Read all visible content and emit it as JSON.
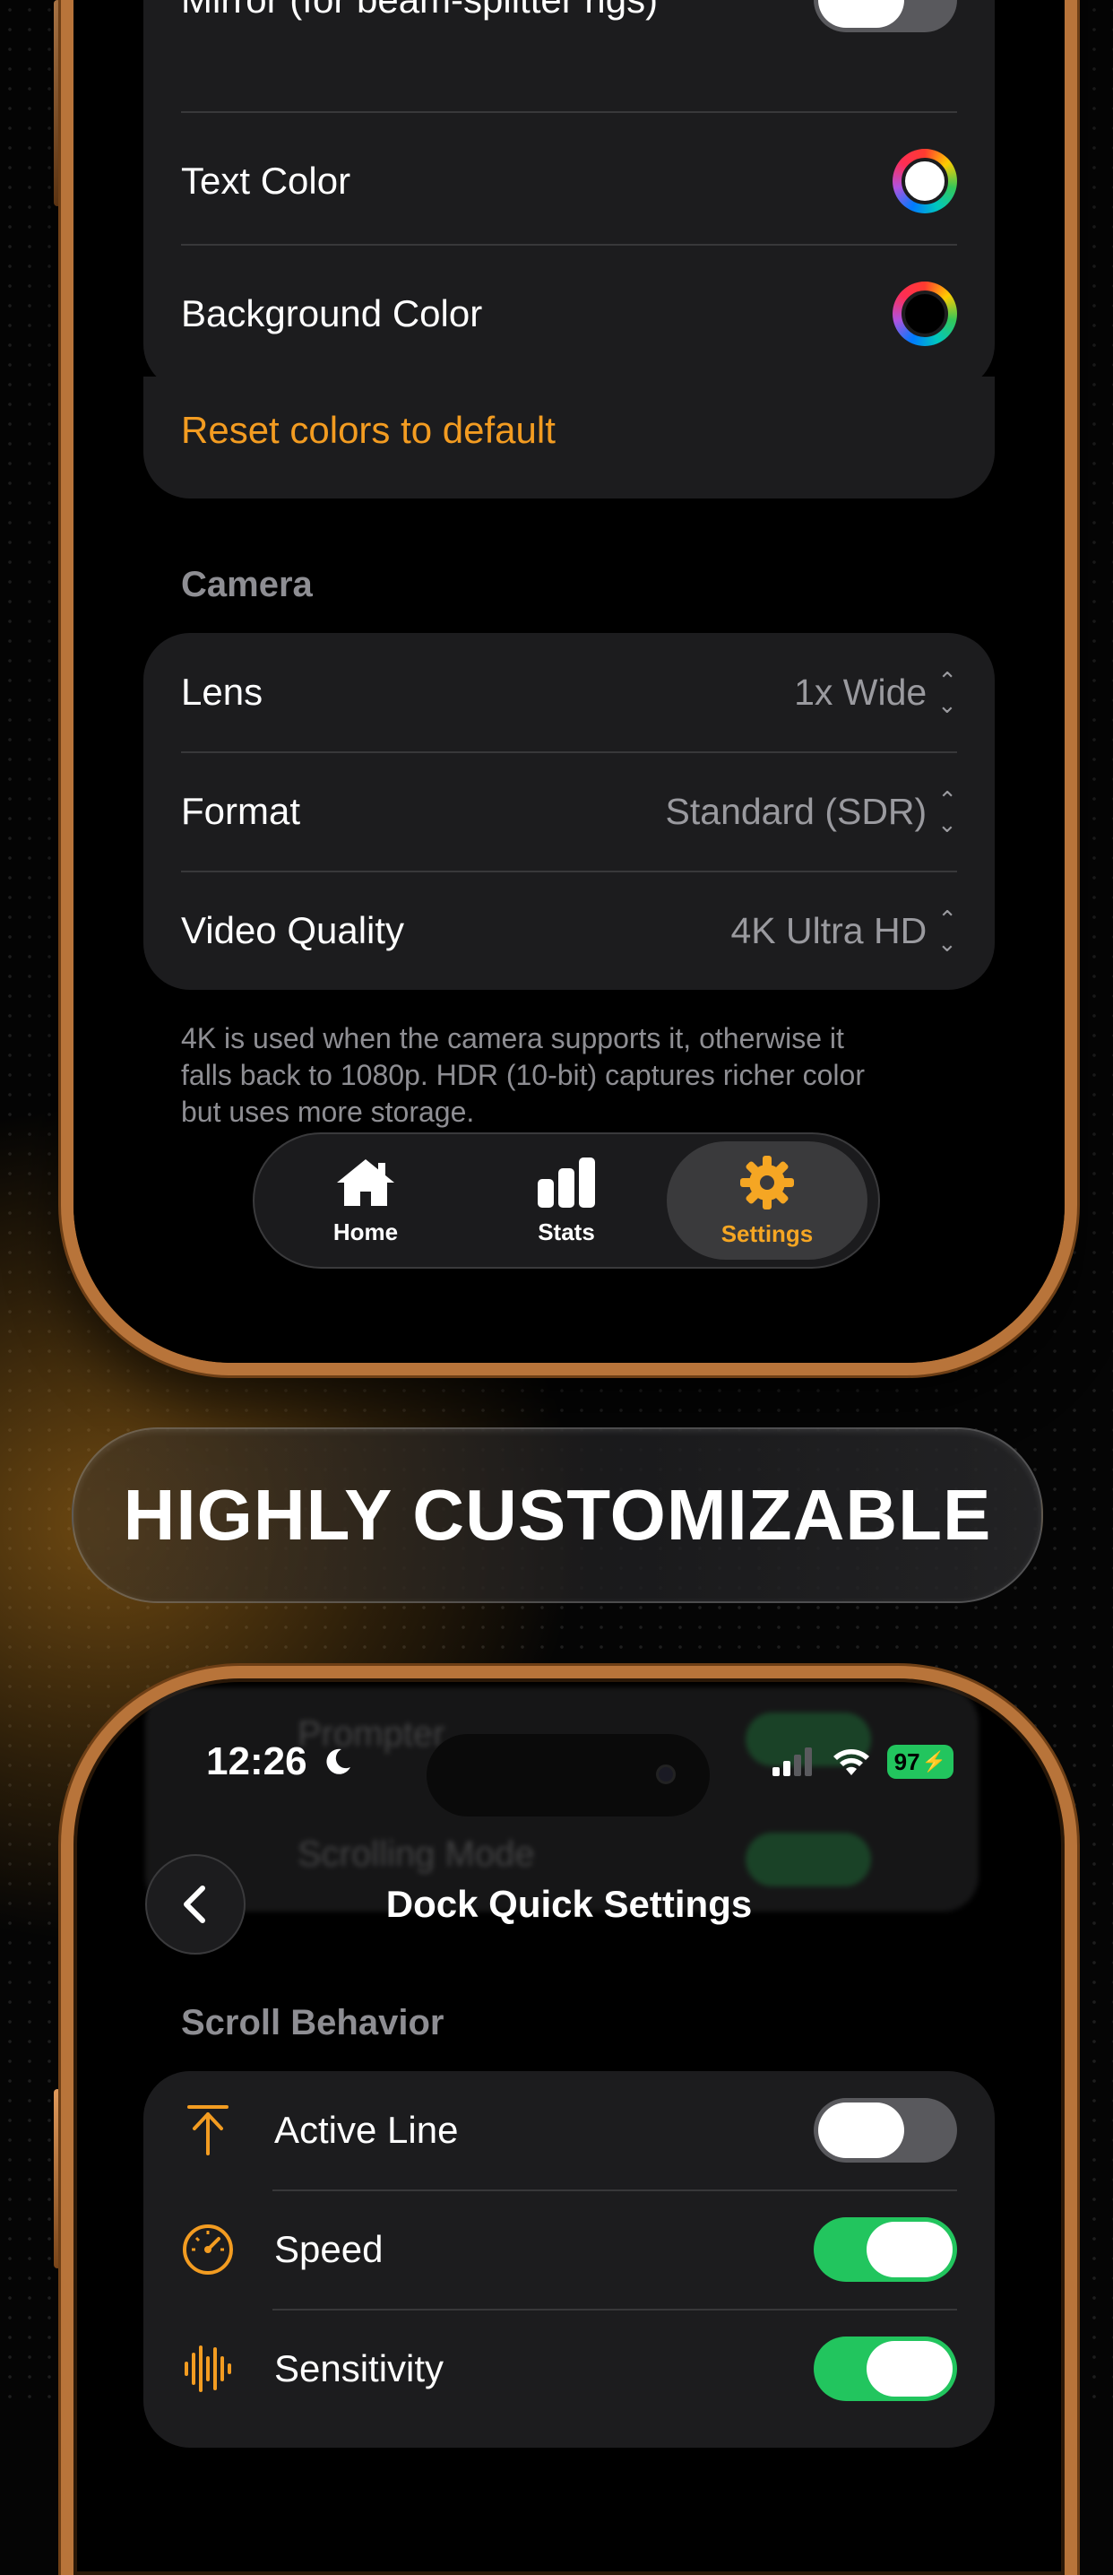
{
  "phone_top": {
    "display_card": {
      "rows": [
        {
          "label": "Mirror (for beam-splitter rigs)",
          "control": "toggle",
          "state": "off"
        },
        {
          "label": "Text Color",
          "control": "color-well",
          "color": "#ffffff"
        },
        {
          "label": "Background Color",
          "control": "color-well",
          "color": "#000000"
        }
      ],
      "reset_label": "Reset colors to default"
    },
    "camera": {
      "section_title": "Camera",
      "rows": [
        {
          "label": "Lens",
          "value": "1x Wide"
        },
        {
          "label": "Format",
          "value": "Standard (SDR)"
        },
        {
          "label": "Video Quality",
          "value": "4K Ultra HD"
        }
      ],
      "footnote_lines": [
        "4K is used when the camera supports it, otherwise it",
        "falls back to 1080p. HDR (10-bit) captures richer color",
        "but uses more storage."
      ]
    },
    "tabbar": {
      "tabs": [
        {
          "label": "Home",
          "icon": "house-icon",
          "active": false
        },
        {
          "label": "Stats",
          "icon": "chart-bars-icon",
          "active": false
        },
        {
          "label": "Settings",
          "icon": "gear-icon",
          "active": true
        }
      ]
    }
  },
  "banner": {
    "text": "HIGHLY CUSTOMIZABLE"
  },
  "phone_bottom": {
    "status_bar": {
      "time": "12:26",
      "battery": "97"
    },
    "ghost_rows": [
      "Prompter",
      "Scrolling Mode"
    ],
    "nav": {
      "title": "Dock Quick Settings"
    },
    "scroll_behavior": {
      "section_title": "Scroll Behavior",
      "rows": [
        {
          "label": "Active Line",
          "icon": "arrow-up-to-line-icon",
          "state": "off"
        },
        {
          "label": "Speed",
          "icon": "gauge-icon",
          "state": "on"
        },
        {
          "label": "Sensitivity",
          "icon": "waveform-icon",
          "state": "on"
        }
      ]
    }
  },
  "colors": {
    "accent": "#f39c21",
    "frame": "#b8743a",
    "toggle_on": "#22c55e",
    "card": "#1c1c1e"
  }
}
